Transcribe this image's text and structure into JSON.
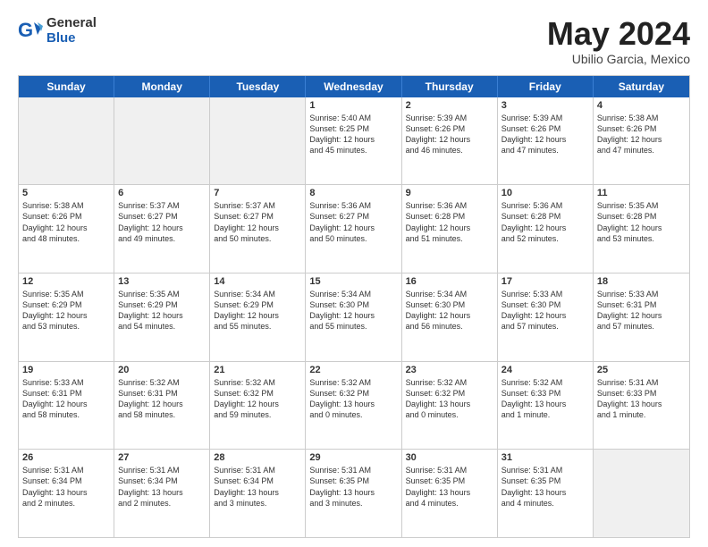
{
  "header": {
    "logo_general": "General",
    "logo_blue": "Blue",
    "month_title": "May 2024",
    "location": "Ubilio Garcia, Mexico"
  },
  "days_of_week": [
    "Sunday",
    "Monday",
    "Tuesday",
    "Wednesday",
    "Thursday",
    "Friday",
    "Saturday"
  ],
  "weeks": [
    [
      {
        "day": "",
        "text": ""
      },
      {
        "day": "",
        "text": ""
      },
      {
        "day": "",
        "text": ""
      },
      {
        "day": "1",
        "text": "Sunrise: 5:40 AM\nSunset: 6:25 PM\nDaylight: 12 hours\nand 45 minutes."
      },
      {
        "day": "2",
        "text": "Sunrise: 5:39 AM\nSunset: 6:26 PM\nDaylight: 12 hours\nand 46 minutes."
      },
      {
        "day": "3",
        "text": "Sunrise: 5:39 AM\nSunset: 6:26 PM\nDaylight: 12 hours\nand 47 minutes."
      },
      {
        "day": "4",
        "text": "Sunrise: 5:38 AM\nSunset: 6:26 PM\nDaylight: 12 hours\nand 47 minutes."
      }
    ],
    [
      {
        "day": "5",
        "text": "Sunrise: 5:38 AM\nSunset: 6:26 PM\nDaylight: 12 hours\nand 48 minutes."
      },
      {
        "day": "6",
        "text": "Sunrise: 5:37 AM\nSunset: 6:27 PM\nDaylight: 12 hours\nand 49 minutes."
      },
      {
        "day": "7",
        "text": "Sunrise: 5:37 AM\nSunset: 6:27 PM\nDaylight: 12 hours\nand 50 minutes."
      },
      {
        "day": "8",
        "text": "Sunrise: 5:36 AM\nSunset: 6:27 PM\nDaylight: 12 hours\nand 50 minutes."
      },
      {
        "day": "9",
        "text": "Sunrise: 5:36 AM\nSunset: 6:28 PM\nDaylight: 12 hours\nand 51 minutes."
      },
      {
        "day": "10",
        "text": "Sunrise: 5:36 AM\nSunset: 6:28 PM\nDaylight: 12 hours\nand 52 minutes."
      },
      {
        "day": "11",
        "text": "Sunrise: 5:35 AM\nSunset: 6:28 PM\nDaylight: 12 hours\nand 53 minutes."
      }
    ],
    [
      {
        "day": "12",
        "text": "Sunrise: 5:35 AM\nSunset: 6:29 PM\nDaylight: 12 hours\nand 53 minutes."
      },
      {
        "day": "13",
        "text": "Sunrise: 5:35 AM\nSunset: 6:29 PM\nDaylight: 12 hours\nand 54 minutes."
      },
      {
        "day": "14",
        "text": "Sunrise: 5:34 AM\nSunset: 6:29 PM\nDaylight: 12 hours\nand 55 minutes."
      },
      {
        "day": "15",
        "text": "Sunrise: 5:34 AM\nSunset: 6:30 PM\nDaylight: 12 hours\nand 55 minutes."
      },
      {
        "day": "16",
        "text": "Sunrise: 5:34 AM\nSunset: 6:30 PM\nDaylight: 12 hours\nand 56 minutes."
      },
      {
        "day": "17",
        "text": "Sunrise: 5:33 AM\nSunset: 6:30 PM\nDaylight: 12 hours\nand 57 minutes."
      },
      {
        "day": "18",
        "text": "Sunrise: 5:33 AM\nSunset: 6:31 PM\nDaylight: 12 hours\nand 57 minutes."
      }
    ],
    [
      {
        "day": "19",
        "text": "Sunrise: 5:33 AM\nSunset: 6:31 PM\nDaylight: 12 hours\nand 58 minutes."
      },
      {
        "day": "20",
        "text": "Sunrise: 5:32 AM\nSunset: 6:31 PM\nDaylight: 12 hours\nand 58 minutes."
      },
      {
        "day": "21",
        "text": "Sunrise: 5:32 AM\nSunset: 6:32 PM\nDaylight: 12 hours\nand 59 minutes."
      },
      {
        "day": "22",
        "text": "Sunrise: 5:32 AM\nSunset: 6:32 PM\nDaylight: 13 hours\nand 0 minutes."
      },
      {
        "day": "23",
        "text": "Sunrise: 5:32 AM\nSunset: 6:32 PM\nDaylight: 13 hours\nand 0 minutes."
      },
      {
        "day": "24",
        "text": "Sunrise: 5:32 AM\nSunset: 6:33 PM\nDaylight: 13 hours\nand 1 minute."
      },
      {
        "day": "25",
        "text": "Sunrise: 5:31 AM\nSunset: 6:33 PM\nDaylight: 13 hours\nand 1 minute."
      }
    ],
    [
      {
        "day": "26",
        "text": "Sunrise: 5:31 AM\nSunset: 6:34 PM\nDaylight: 13 hours\nand 2 minutes."
      },
      {
        "day": "27",
        "text": "Sunrise: 5:31 AM\nSunset: 6:34 PM\nDaylight: 13 hours\nand 2 minutes."
      },
      {
        "day": "28",
        "text": "Sunrise: 5:31 AM\nSunset: 6:34 PM\nDaylight: 13 hours\nand 3 minutes."
      },
      {
        "day": "29",
        "text": "Sunrise: 5:31 AM\nSunset: 6:35 PM\nDaylight: 13 hours\nand 3 minutes."
      },
      {
        "day": "30",
        "text": "Sunrise: 5:31 AM\nSunset: 6:35 PM\nDaylight: 13 hours\nand 4 minutes."
      },
      {
        "day": "31",
        "text": "Sunrise: 5:31 AM\nSunset: 6:35 PM\nDaylight: 13 hours\nand 4 minutes."
      },
      {
        "day": "",
        "text": ""
      }
    ]
  ]
}
